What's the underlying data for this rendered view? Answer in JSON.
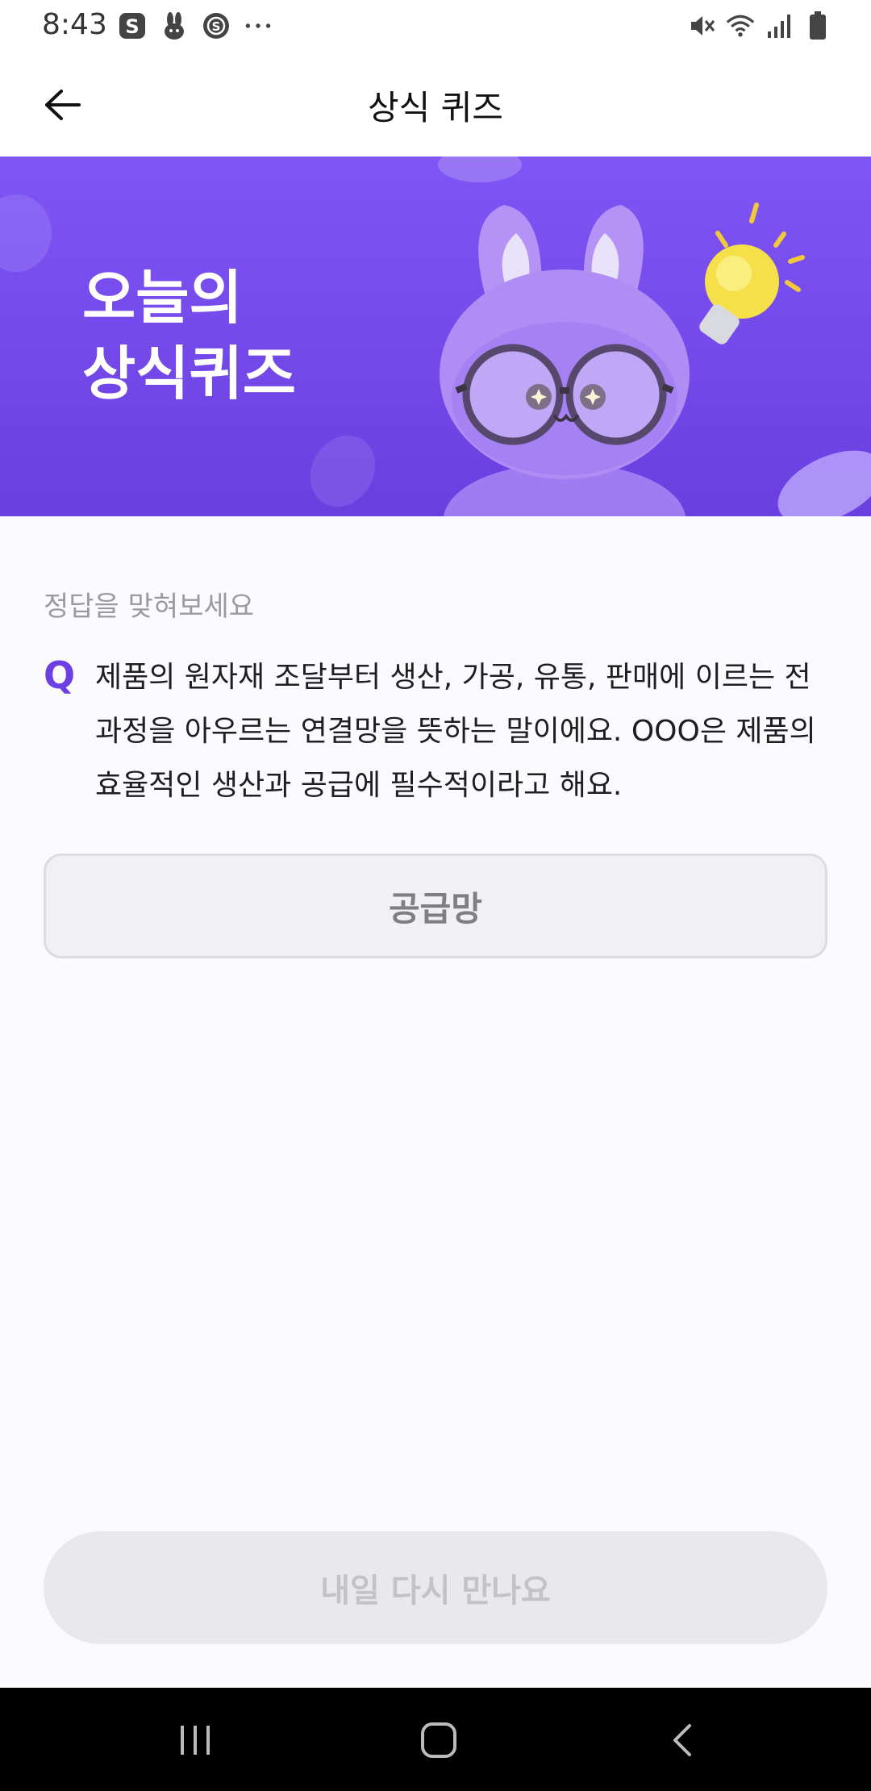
{
  "status_bar": {
    "time": "8:43",
    "left_icons": [
      "s-app-icon",
      "rabbit-icon",
      "s-coin-icon",
      "more-dots-icon"
    ],
    "right_icons": [
      "mute-icon",
      "wifi-icon",
      "signal-icon",
      "battery-icon"
    ]
  },
  "header": {
    "title": "상식 퀴즈",
    "back_icon": "arrow-left-icon"
  },
  "banner": {
    "line1": "오늘의",
    "line2": "상식퀴즈",
    "mascot": "rabbit-with-glasses",
    "bulb": "lightbulb-icon",
    "background_color": "#7b50f0"
  },
  "quiz": {
    "hint": "정답을 맞혀보세요",
    "q_label": "Q",
    "question": "제품의 원자재 조달부터 생산, 가공, 유통, 판매에 이르는 전 과정을 아우르는 연결망을 뜻하는 말이에요. OOO은 제품의 효율적인 생산과 공급에 필수적이라고 해요.",
    "answer": "공급망"
  },
  "footer": {
    "cta_label": "내일 다시 만나요"
  },
  "colors": {
    "accent": "#6c3fe3",
    "banner_top": "#7f55f5",
    "banner_bottom": "#6a3fe0"
  }
}
